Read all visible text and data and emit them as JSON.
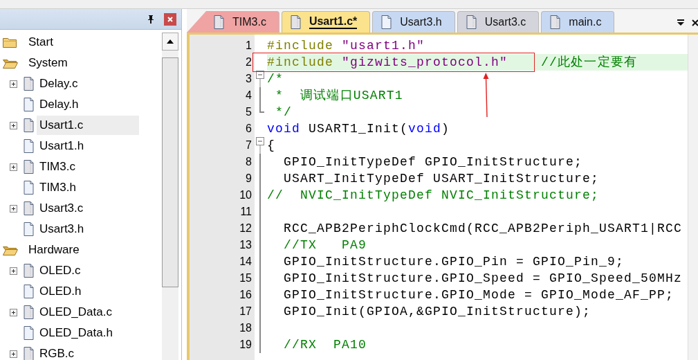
{
  "project_panel": {
    "tree": [
      {
        "label": "Start",
        "kind": "group",
        "expanded": false,
        "selected": false
      },
      {
        "label": "System",
        "kind": "group",
        "expanded": true,
        "selected": false,
        "children": [
          {
            "label": "Delay.c",
            "kind": "c-file",
            "selected": false
          },
          {
            "label": "Delay.h",
            "kind": "h-file",
            "selected": false
          },
          {
            "label": "Usart1.c",
            "kind": "c-file",
            "selected": true
          },
          {
            "label": "Usart1.h",
            "kind": "h-file",
            "selected": false
          },
          {
            "label": "TIM3.c",
            "kind": "c-file",
            "selected": false
          },
          {
            "label": "TIM3.h",
            "kind": "h-file",
            "selected": false
          },
          {
            "label": "Usart3.c",
            "kind": "c-file",
            "selected": false
          },
          {
            "label": "Usart3.h",
            "kind": "h-file",
            "selected": false
          }
        ]
      },
      {
        "label": "Hardware",
        "kind": "group",
        "expanded": true,
        "selected": false,
        "children": [
          {
            "label": "OLED.c",
            "kind": "c-file",
            "selected": false
          },
          {
            "label": "OLED.h",
            "kind": "h-file",
            "selected": false
          },
          {
            "label": "OLED_Data.c",
            "kind": "c-file",
            "selected": false
          },
          {
            "label": "OLED_Data.h",
            "kind": "h-file",
            "selected": false
          },
          {
            "label": "RGB.c",
            "kind": "c-file",
            "selected": false
          }
        ]
      }
    ]
  },
  "editor": {
    "tabs": [
      {
        "label": "TIM3.c",
        "kind": "c-file",
        "selected": false,
        "color": "#f0a3a3"
      },
      {
        "label": "Usart1.c*",
        "kind": "c-file",
        "selected": true,
        "color": "#fbe28c"
      },
      {
        "label": "Usart3.h",
        "kind": "h-file",
        "selected": false,
        "color": "#c7d8f2"
      },
      {
        "label": "Usart3.c",
        "kind": "c-file",
        "selected": false,
        "color": "#d4d4dc"
      },
      {
        "label": "main.c",
        "kind": "c-file",
        "selected": false,
        "color": "#c7d8f2"
      }
    ],
    "lines": [
      {
        "number": "1",
        "kind": "plain",
        "highlighted": false,
        "tokens": [
          {
            "kind": "preprocessor",
            "text": "#include "
          },
          {
            "kind": "string",
            "text": "\"usart1.h\""
          }
        ]
      },
      {
        "number": "2",
        "kind": "plain",
        "highlighted": true,
        "tokens": [
          {
            "kind": "preprocessor",
            "text": "#include "
          },
          {
            "kind": "string",
            "text": "\"gizwits_protocol.h\""
          },
          {
            "kind": "comment",
            "text": "    //此处一定要有"
          }
        ]
      },
      {
        "number": "3",
        "kind": "fold-start",
        "highlighted": false,
        "tokens": [
          {
            "kind": "comment",
            "text": "/*"
          }
        ]
      },
      {
        "number": "4",
        "kind": "fold-body",
        "highlighted": false,
        "tokens": [
          {
            "kind": "comment",
            "text": " *  调试端口USART1"
          }
        ]
      },
      {
        "number": "5",
        "kind": "fold-end",
        "highlighted": false,
        "tokens": [
          {
            "kind": "comment",
            "text": " */"
          }
        ]
      },
      {
        "number": "6",
        "kind": "plain",
        "highlighted": false,
        "tokens": [
          {
            "kind": "keyword",
            "text": "void"
          },
          {
            "kind": "plain",
            "text": " USART1_Init("
          },
          {
            "kind": "keyword",
            "text": "void"
          },
          {
            "kind": "plain",
            "text": ")"
          }
        ]
      },
      {
        "number": "7",
        "kind": "fold-start",
        "highlighted": false,
        "tokens": [
          {
            "kind": "plain",
            "text": "{"
          }
        ]
      },
      {
        "number": "8",
        "kind": "fold-body",
        "highlighted": false,
        "tokens": [
          {
            "kind": "plain",
            "text": "  GPIO_InitTypeDef GPIO_InitStructure;"
          }
        ]
      },
      {
        "number": "9",
        "kind": "fold-body",
        "highlighted": false,
        "tokens": [
          {
            "kind": "plain",
            "text": "  USART_InitTypeDef USART_InitStructure;"
          }
        ]
      },
      {
        "number": "10",
        "kind": "fold-body",
        "highlighted": false,
        "tokens": [
          {
            "kind": "comment",
            "text": "//  NVIC_InitTypeDef NVIC_InitStructure;"
          }
        ]
      },
      {
        "number": "11",
        "kind": "fold-body",
        "highlighted": false
      },
      {
        "number": "12",
        "kind": "fold-body",
        "highlighted": false,
        "tokens": [
          {
            "kind": "plain",
            "text": "  RCC_APB2PeriphClockCmd(RCC_APB2Periph_USART1|RCC"
          }
        ]
      },
      {
        "number": "13",
        "kind": "fold-body",
        "highlighted": false,
        "tokens": [
          {
            "kind": "comment",
            "text": "  //TX   PA9"
          }
        ]
      },
      {
        "number": "14",
        "kind": "fold-body",
        "highlighted": false,
        "tokens": [
          {
            "kind": "plain",
            "text": "  GPIO_InitStructure.GPIO_Pin = GPIO_Pin_9;"
          }
        ]
      },
      {
        "number": "15",
        "kind": "fold-body",
        "highlighted": false,
        "tokens": [
          {
            "kind": "plain",
            "text": "  GPIO_InitStructure.GPIO_Speed = GPIO_Speed_50MHz"
          }
        ]
      },
      {
        "number": "16",
        "kind": "fold-body",
        "highlighted": false,
        "tokens": [
          {
            "kind": "plain",
            "text": "  GPIO_InitStructure.GPIO_Mode = GPIO_Mode_AF_PP;"
          }
        ]
      },
      {
        "number": "17",
        "kind": "fold-body",
        "highlighted": false,
        "tokens": [
          {
            "kind": "plain",
            "text": "  GPIO_Init(GPIOA,&GPIO_InitStructure);"
          }
        ]
      },
      {
        "number": "18",
        "kind": "fold-body",
        "highlighted": false
      },
      {
        "number": "19",
        "kind": "fold-body",
        "highlighted": false,
        "tokens": [
          {
            "kind": "comment",
            "text": "  //RX  PA10"
          }
        ]
      }
    ]
  }
}
